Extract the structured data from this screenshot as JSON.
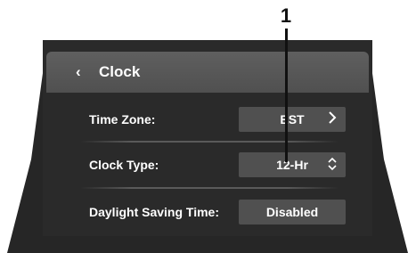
{
  "callout": {
    "number": "1"
  },
  "header": {
    "back_icon": "‹",
    "title": "Clock"
  },
  "settings": [
    {
      "label": "Time Zone:",
      "value": "EST",
      "control_icon": "›"
    },
    {
      "label": "Clock Type:",
      "value": "12-Hr",
      "control_icon": "⌃⌄"
    },
    {
      "label": "Daylight Saving Time:",
      "value": "Disabled",
      "control_icon": ""
    }
  ],
  "colors": {
    "screen_background": "#262626",
    "header_background": "#5a5a5a",
    "value_box": "#505050",
    "text": "#ffffff"
  }
}
